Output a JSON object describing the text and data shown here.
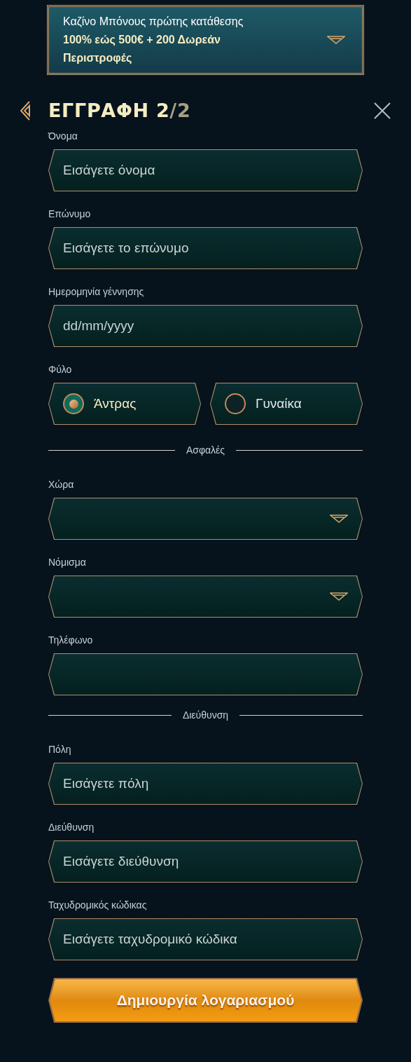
{
  "banner": {
    "line": "Καζίνο Μπόνους πρώτης κατάθεσης",
    "bold": "100% εώς 500€ + 200 Δωρεάν Περιστροφές"
  },
  "title": "ΕΓΓΡΑΦΗ 2",
  "title_dim": "/2",
  "form": [
    {
      "kind": "input",
      "label": "Όνομα",
      "placeholder": "Εισάγετε όνομα"
    },
    {
      "kind": "input",
      "label": "Επώνυμο",
      "placeholder": "Εισάγετε το επώνυμο"
    },
    {
      "kind": "input",
      "label": "Ημερομηνία γέννησης",
      "placeholder": "dd/mm/yyyy"
    },
    {
      "kind": "radio",
      "label": "Φύλο",
      "options": [
        {
          "label": "Άντρας",
          "selected": true
        },
        {
          "label": "Γυναίκα",
          "selected": false
        }
      ]
    },
    {
      "kind": "divider",
      "label": "Ασφαλές"
    },
    {
      "kind": "select",
      "label": "Χώρα"
    },
    {
      "kind": "select",
      "label": "Νόμισμα"
    },
    {
      "kind": "input",
      "label": "Τηλέφωνο"
    },
    {
      "kind": "divider",
      "label": "Διεύθυνση"
    },
    {
      "kind": "input",
      "label": "Πόλη",
      "placeholder": "Εισάγετε πόλη"
    },
    {
      "kind": "input",
      "label": "Διεύθυνση",
      "placeholder": "Εισάγετε διεύθυνση"
    },
    {
      "kind": "input",
      "label": "Ταχυδρομικός κώδικας",
      "placeholder": "Εισάγετε ταχυδρομικό κώδικα"
    }
  ],
  "submit": "Δημιουργία λογαριασμού"
}
